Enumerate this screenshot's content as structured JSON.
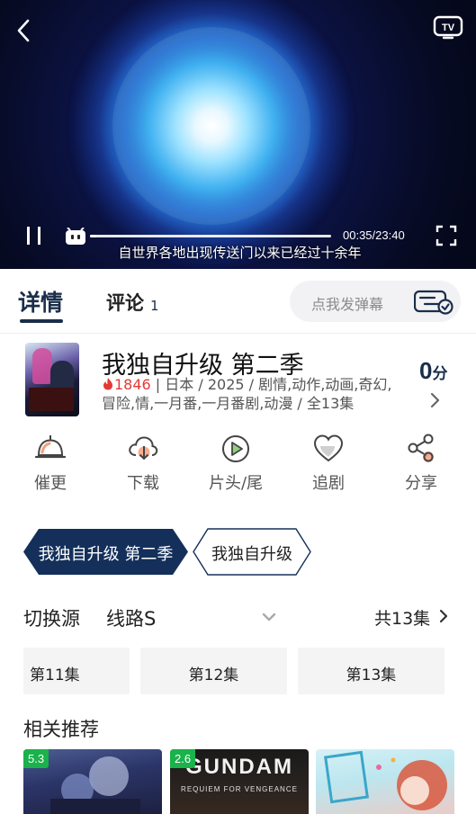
{
  "player": {
    "time": "00:35/23:40",
    "progress_fraction": 0.0246,
    "subtitle": "自世界各地出现传送门以来已经过十余年"
  },
  "tabs": {
    "details": "详情",
    "comments": "评论",
    "comments_count": "1",
    "danmu_placeholder": "点我发弹幕"
  },
  "info": {
    "title": "我独自升级 第二季",
    "score_value": "0",
    "score_unit": "分",
    "heat": "1846",
    "meta_line": " | 日本 / 2025 / 剧情,动作,动画,奇幻,冒险,情,一月番,一月番剧,动漫 / 全13集"
  },
  "actions": [
    {
      "label": "催更",
      "icon": "bell-icon"
    },
    {
      "label": "下载",
      "icon": "cloud-download-icon"
    },
    {
      "label": "片头/尾",
      "icon": "play-circle-icon"
    },
    {
      "label": "追剧",
      "icon": "heart-icon"
    },
    {
      "label": "分享",
      "icon": "share-icon"
    }
  ],
  "seasons": [
    {
      "label": "我独自升级 第二季",
      "selected": true
    },
    {
      "label": "我独自升级",
      "selected": false
    }
  ],
  "source": {
    "label": "切换源",
    "value": "线路S",
    "total": "共13集"
  },
  "episodes": [
    "第11集",
    "第12集",
    "第13集"
  ],
  "recommend": {
    "title": "相关推荐",
    "items": [
      {
        "score": "5.3"
      },
      {
        "score": "2.6",
        "logo": "GUNDAM",
        "logo_sub": "REQUIEM FOR VENGEANCE"
      },
      {
        "score": ""
      }
    ]
  },
  "colors": {
    "accent": "#1a2e4a",
    "heat": "#e53935",
    "badge": "#19b24b"
  }
}
